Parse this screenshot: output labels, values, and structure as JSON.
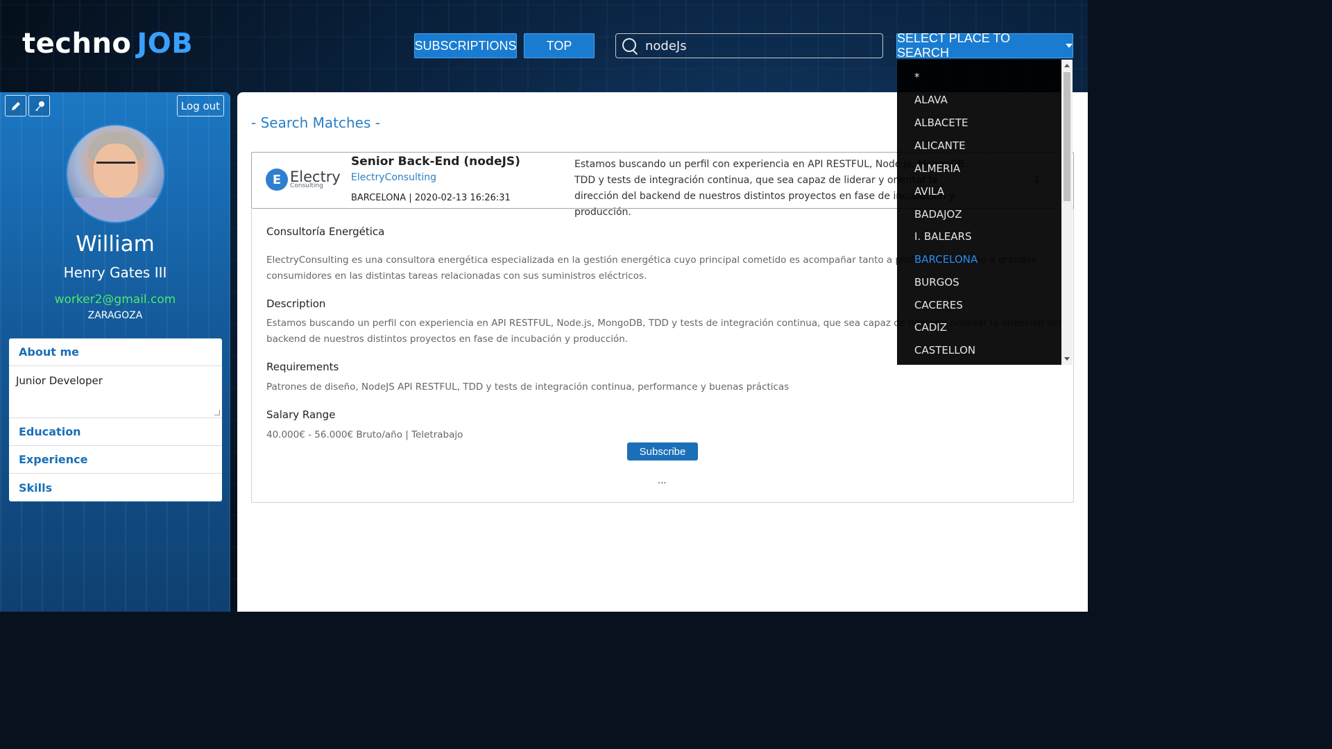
{
  "header": {
    "logo_text": "techno",
    "logo_accent": "JOB",
    "subscriptions_label": "SUBSCRIPTIONS",
    "top_label": "TOP",
    "search_value": "nodeJs",
    "place_label": "SELECT PLACE TO SEARCH"
  },
  "sidebar": {
    "logout_label": "Log out",
    "name_first": "William",
    "name_rest": "Henry Gates III",
    "email": "worker2@gmail.com",
    "city": "ZARAGOZA",
    "about_label": "About me",
    "about_text": "Junior Developer",
    "education_label": "Education",
    "experience_label": "Experience",
    "skills_label": "Skills"
  },
  "main": {
    "title": "- Search Matches -",
    "job": {
      "logo_big": "Electry",
      "logo_small": "Consulting",
      "logo_letter": "E",
      "title": "Senior Back-End (nodeJS)",
      "company": "ElectryConsulting",
      "meta": "BARCELONA | 2020-02-13 16:26:31",
      "summary": "Estamos buscando un perfil con experiencia en API RESTFUL, Node.js, MongoDB, TDD y tests de integración continua, que sea capaz de liderar y orientar la dirección del backend de nuestros distintos proyectos en fase de incubación y producción.",
      "count": "1"
    },
    "company_name": "Consultoría Energética",
    "company_desc": "ElectryConsulting es una consultora energética especializada en la gestión energética cuyo principal cometido es acompañar tanto a profesionales como a grandes consumidores en las distintas tareas relacionadas con sus suministros eléctricos.",
    "description_label": "Description",
    "description_text": "Estamos buscando un perfil con experiencia en API RESTFUL, Node.js, MongoDB, TDD y tests de integración continua, que sea capaz de liderar y orientar la dirección del backend de nuestros distintos proyectos en fase de incubación y producción.",
    "requirements_label": "Requirements",
    "requirements_text": "Patrones de diseño, NodeJS API RESTFUL, TDD y tests de integración continua, performance y buenas prácticas",
    "salary_label": "Salary Range",
    "salary_text": "40.000€ - 56.000€ Bruto/año | Teletrabajo",
    "subscribe_label": "Subscribe",
    "ellipsis": "..."
  },
  "dropdown": {
    "items": [
      "*",
      "ALAVA",
      "ALBACETE",
      "ALICANTE",
      "ALMERIA",
      "AVILA",
      "BADAJOZ",
      "I. BALEARS",
      "BARCELONA",
      "BURGOS",
      "CACERES",
      "CADIZ",
      "CASTELLON"
    ],
    "active": "BARCELONA"
  },
  "colors": {
    "accent": "#1a7cd0",
    "email_green": "#4dea6c",
    "link_blue": "#2a7fc4",
    "dropdown_active": "#2a8ff0"
  }
}
